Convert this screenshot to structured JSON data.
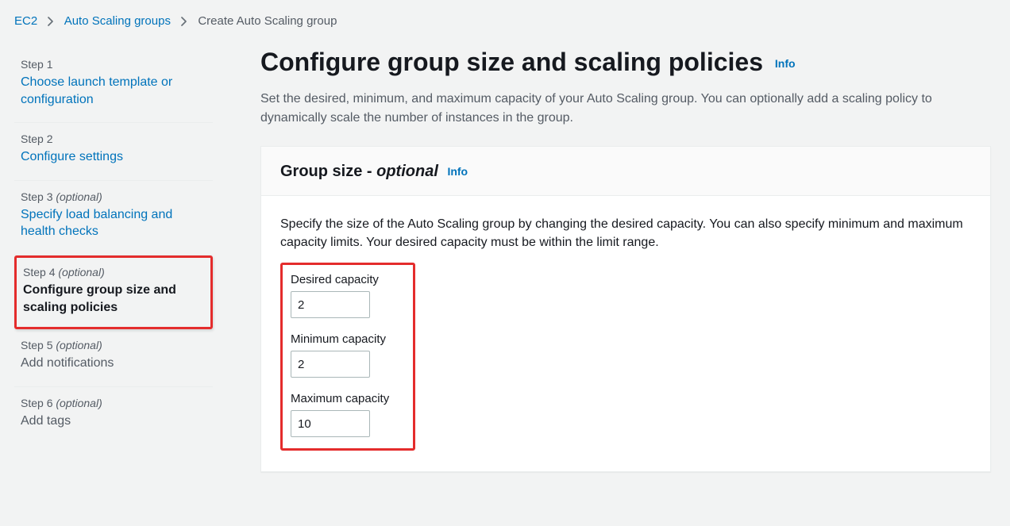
{
  "breadcrumb": {
    "root": "EC2",
    "group": "Auto Scaling groups",
    "current": "Create Auto Scaling group"
  },
  "steps": [
    {
      "num": "Step 1",
      "opt": "",
      "title": "Choose launch template or configuration",
      "state": "link"
    },
    {
      "num": "Step 2",
      "opt": "",
      "title": "Configure settings",
      "state": "link"
    },
    {
      "num": "Step 3",
      "opt": "(optional)",
      "title": "Specify load balancing and health checks",
      "state": "link"
    },
    {
      "num": "Step 4",
      "opt": "(optional)",
      "title": "Configure group size and scaling policies",
      "state": "active"
    },
    {
      "num": "Step 5",
      "opt": "(optional)",
      "title": "Add notifications",
      "state": "future"
    },
    {
      "num": "Step 6",
      "opt": "(optional)",
      "title": "Add tags",
      "state": "future"
    }
  ],
  "main": {
    "title": "Configure group size and scaling policies",
    "info": "Info",
    "desc": "Set the desired, minimum, and maximum capacity of your Auto Scaling group. You can optionally add a scaling policy to dynamically scale the number of instances in the group."
  },
  "panel": {
    "title_prefix": "Group size - ",
    "title_opt": "optional",
    "info": "Info",
    "desc": "Specify the size of the Auto Scaling group by changing the desired capacity. You can also specify minimum and maximum capacity limits. Your desired capacity must be within the limit range.",
    "fields": {
      "desired": {
        "label": "Desired capacity",
        "value": "2"
      },
      "min": {
        "label": "Minimum capacity",
        "value": "2"
      },
      "max": {
        "label": "Maximum capacity",
        "value": "10"
      }
    }
  }
}
